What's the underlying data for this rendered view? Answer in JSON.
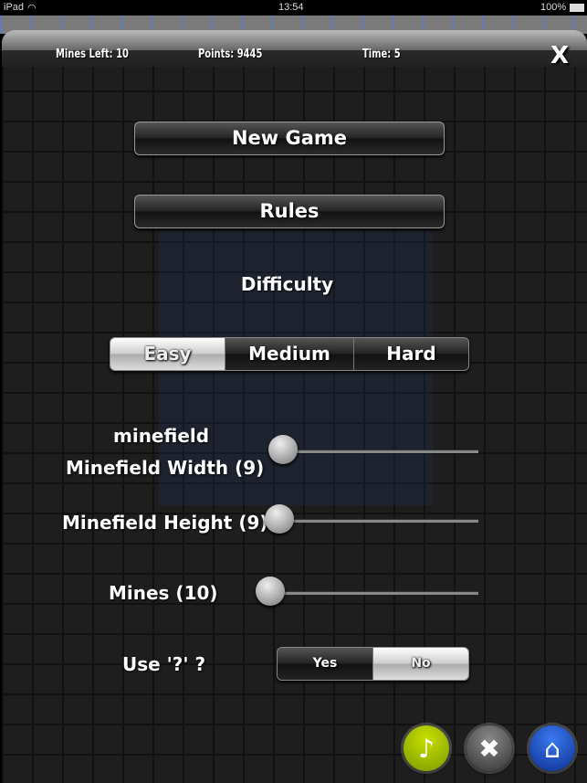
{
  "status_bar": {
    "device": "iPad",
    "time": "13:54",
    "battery": "100%"
  },
  "header": {
    "mines_left": "Mines Left: 10",
    "points": "Points: 9445",
    "time": "Time: 5",
    "close": "X"
  },
  "menu": {
    "new_game": "New Game",
    "rules": "Rules",
    "difficulty_label": "Difficulty",
    "difficulty_options": [
      "Easy",
      "Medium",
      "Hard"
    ],
    "difficulty_selected": "Easy"
  },
  "sliders": {
    "minefield_caption": "minefield",
    "width_label": "Minefield Width (9)",
    "width_value": 9,
    "height_label": "Minefield Height (9)",
    "height_value": 9,
    "mines_label": "Mines (10)",
    "mines_value": 10
  },
  "question": {
    "label": "Use '?' ?",
    "options": [
      "Yes",
      "No"
    ],
    "selected": "No"
  },
  "footer": {
    "icons": [
      "music-icon",
      "tools-icon",
      "home-icon"
    ],
    "colors": {
      "music": "#9ab800",
      "tools": "#555555",
      "home": "#1a4fc4"
    }
  }
}
